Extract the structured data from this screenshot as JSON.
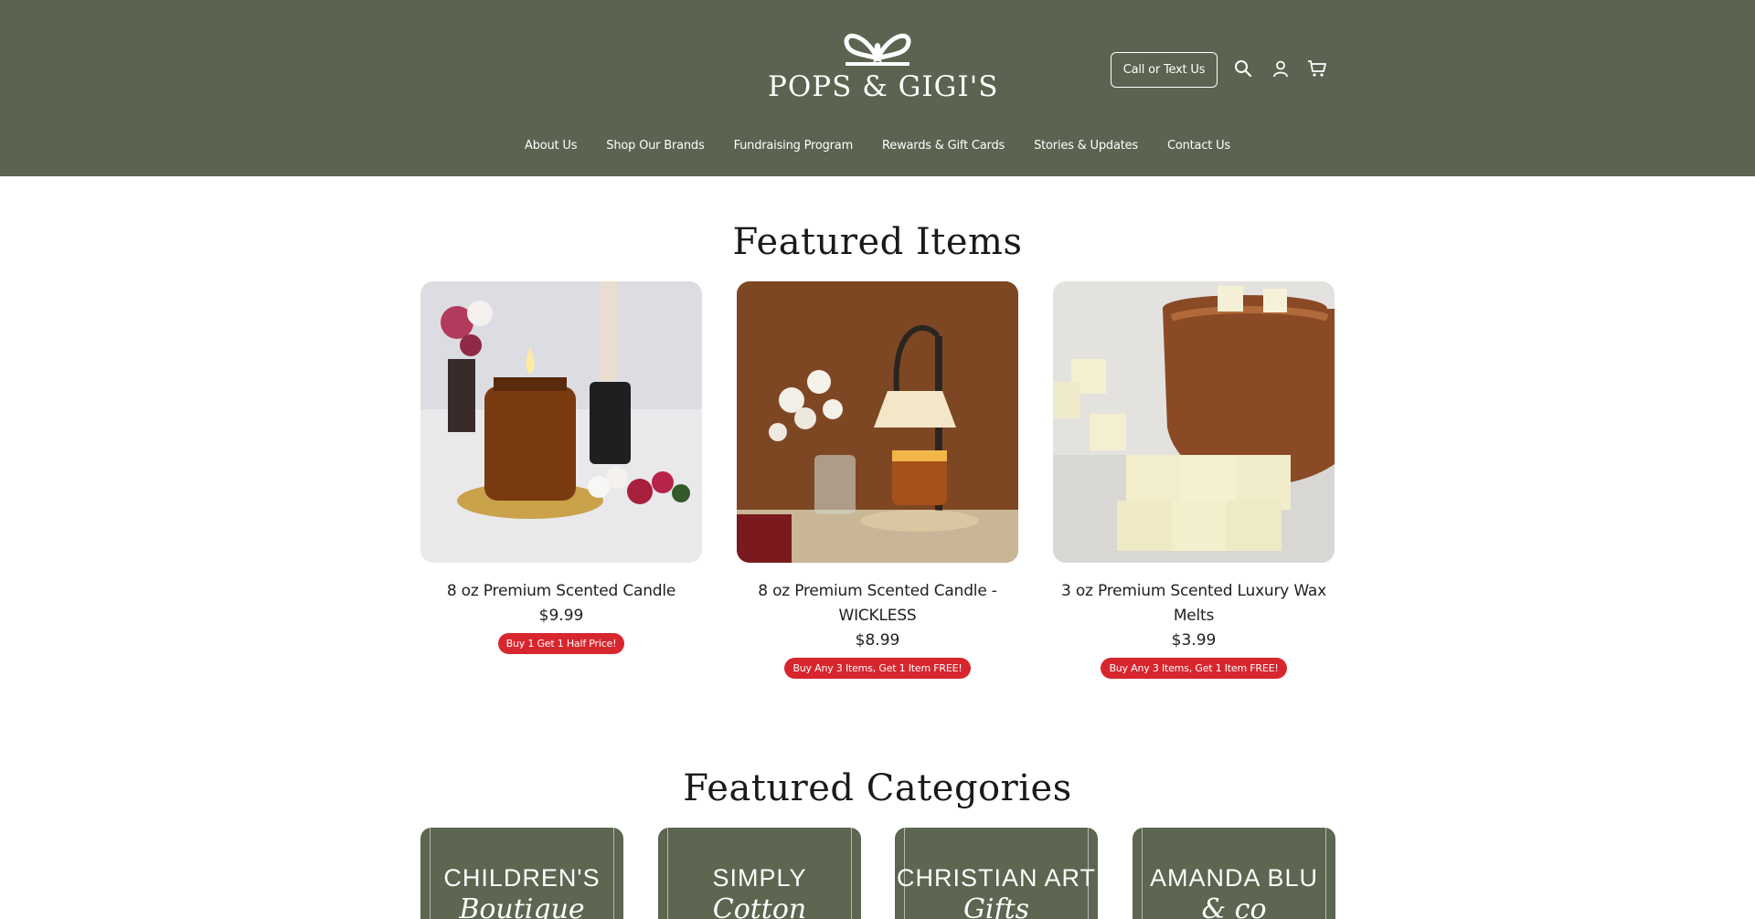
{
  "header": {
    "brand": "POPS & GIGI'S",
    "call_button": "Call or Text Us",
    "icons": [
      "search-icon",
      "account-icon",
      "cart-icon"
    ],
    "bg_color": "#5a6450"
  },
  "nav": {
    "items": [
      {
        "label": "About Us"
      },
      {
        "label": "Shop Our Brands"
      },
      {
        "label": "Fundraising Program"
      },
      {
        "label": "Rewards & Gift Cards"
      },
      {
        "label": "Stories & Updates"
      },
      {
        "label": "Contact Us"
      }
    ]
  },
  "featured_items": {
    "title": "Featured Items",
    "products": [
      {
        "name": "8 oz Premium Scented Candle",
        "price": "$9.99",
        "promo": "Buy 1 Get 1 Half Price!"
      },
      {
        "name": "8 oz Premium Scented Candle - WICKLESS",
        "price": "$8.99",
        "promo": "Buy Any 3 Items, Get 1 Item FREE!"
      },
      {
        "name": "3 oz Premium Scented Luxury Wax Melts",
        "price": "$3.99",
        "promo": "Buy Any 3 Items, Get 1 Item FREE!"
      }
    ]
  },
  "featured_categories": {
    "title": "Featured Categories",
    "items": [
      {
        "label": "CHILDREN'S",
        "script": "Boutique"
      },
      {
        "label": "SIMPLY",
        "script": "Cotton"
      },
      {
        "label": "CHRISTIAN ART",
        "script": "Gifts"
      },
      {
        "label": "AMANDA BLU",
        "script": "& co"
      }
    ]
  },
  "colors": {
    "accent_green": "#5a6450",
    "promo_red": "#d7262e"
  }
}
